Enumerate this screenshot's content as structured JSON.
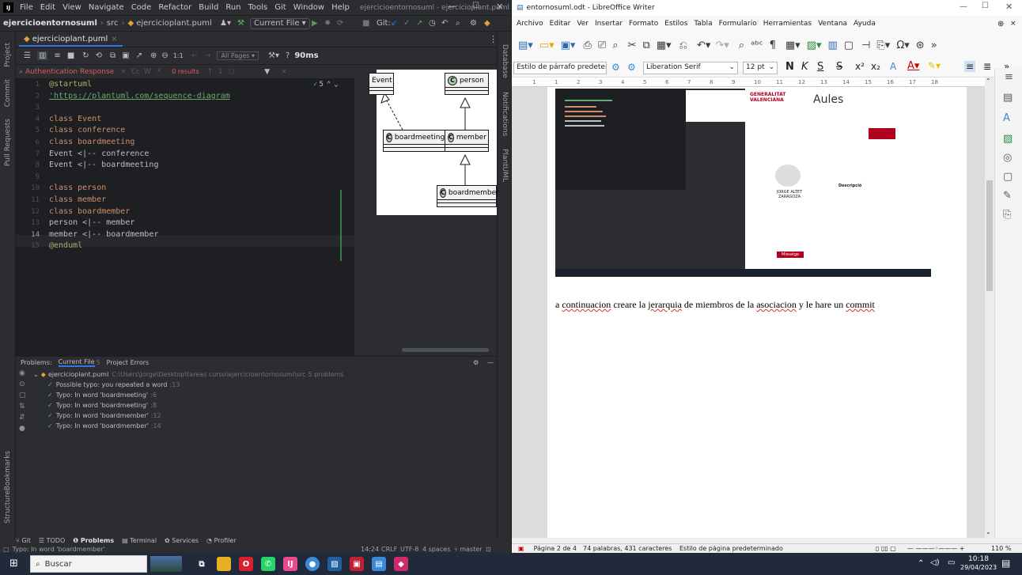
{
  "ij": {
    "logo": "IJ",
    "menu": [
      "File",
      "Edit",
      "View",
      "Navigate",
      "Code",
      "Refactor",
      "Build",
      "Run",
      "Tools",
      "Git",
      "Window",
      "Help"
    ],
    "window_title": "ejercicioentornosuml - ejercicioplant.puml",
    "breadcrumb_project": "ejercicioentornosuml",
    "breadcrumb_src": "src",
    "breadcrumb_file": "ejercicioplant.puml",
    "run_config": "Current File",
    "git_label": "Git:",
    "tab_file": "ejercicioplant.puml",
    "zoom_ratio": "1:1",
    "all_pages": "All Pages",
    "render_time": "90ms",
    "search_text": "Authentication Response",
    "search_results": "0 results",
    "inspections": "5",
    "left_tools": [
      "Project",
      "Commit",
      "Pull Requests",
      "Bookmarks",
      "Structure"
    ],
    "right_tools": [
      "Database",
      "Notifications",
      "PlantUML"
    ],
    "code_lines": [
      {
        "n": "1",
        "text": "@startuml"
      },
      {
        "n": "2",
        "text": "'https://plantuml.com/sequence-diagram"
      },
      {
        "n": "3",
        "text": ""
      },
      {
        "n": "4",
        "text": "class Event"
      },
      {
        "n": "5",
        "text": "class conference"
      },
      {
        "n": "6",
        "text": "class boardmeeting"
      },
      {
        "n": "7",
        "text": "Event <|-- conference"
      },
      {
        "n": "8",
        "text": "Event <|-- boardmeeting"
      },
      {
        "n": "9",
        "text": ""
      },
      {
        "n": "10",
        "text": "class person"
      },
      {
        "n": "11",
        "text": "class member"
      },
      {
        "n": "12",
        "text": "class boardmember"
      },
      {
        "n": "13",
        "text": "person <|-- member"
      },
      {
        "n": "14",
        "text": "member <|-- boardmember"
      },
      {
        "n": "15",
        "text": "@enduml"
      }
    ],
    "uml": {
      "badge": "C",
      "classes": [
        "Event",
        "person",
        "boardmeeting",
        "member",
        "boardmember"
      ]
    },
    "problems": {
      "tab_label": "Problems:",
      "current_file": "Current File",
      "current_file_count": "5",
      "project_errors": "Project Errors",
      "file_row": "ejercicioplant.puml",
      "file_path": "C:\\Users\\Jorge\\Desktop\\tareas curso\\ejercicioentornosuml\\src",
      "file_count": "5 problems",
      "items": [
        {
          "text": "Possible typo: you repeated a word",
          "line": ":13"
        },
        {
          "text": "Typo: In word 'boardmeeting'",
          "line": ":6"
        },
        {
          "text": "Typo: In word 'boardmeeting'",
          "line": ":8"
        },
        {
          "text": "Typo: In word 'boardmember'",
          "line": ":12"
        },
        {
          "text": "Typo: In word 'boardmember'",
          "line": ":14"
        }
      ]
    },
    "bottom_tabs": [
      "Git",
      "TODO",
      "Problems",
      "Terminal",
      "Services",
      "Profiler"
    ],
    "status_left": "Typo: In word 'boardmember'",
    "status_right": {
      "pos": "14:24",
      "eol": "CRLF",
      "enc": "UTF-8",
      "indent": "4 spaces",
      "branch": "master"
    }
  },
  "lo": {
    "title": "entornosuml.odt - LibreOffice Writer",
    "menu": [
      "Archivo",
      "Editar",
      "Ver",
      "Insertar",
      "Formato",
      "Estilos",
      "Tabla",
      "Formulario",
      "Herramientas",
      "Ventana",
      "Ayuda"
    ],
    "para_style": "Estilo de párrafo predetermi",
    "font_name": "Liberation Serif",
    "font_size": "12 pt",
    "bold": "N",
    "italic": "K",
    "underline": "S",
    "strike": "S",
    "ruler": [
      "1",
      "1",
      "2",
      "3",
      "4",
      "5",
      "6",
      "7",
      "8",
      "9",
      "10",
      "11",
      "12",
      "13",
      "14",
      "15",
      "16",
      "17",
      "18"
    ],
    "embedded": {
      "brand": "GENERALITAT VALENCIANA",
      "aules": "Aules",
      "name": "JORGE ALTET ZARAGOZA",
      "details_title": "Descripció",
      "button": "Missatge"
    },
    "doc_text": [
      "a ",
      "continuacion",
      " creare la ",
      "jerarquia",
      " de miembros de la ",
      "asociacion",
      " y le hare un ",
      "commit"
    ],
    "status_page": "Página 2 de 4",
    "status_words": "74 palabras, 431 caracteres",
    "status_style": "Estilo de página predeterminado",
    "zoom": "110 %"
  },
  "taskbar": {
    "search_placeholder": "Buscar",
    "time": "10:18",
    "date": "29/04/2023"
  }
}
